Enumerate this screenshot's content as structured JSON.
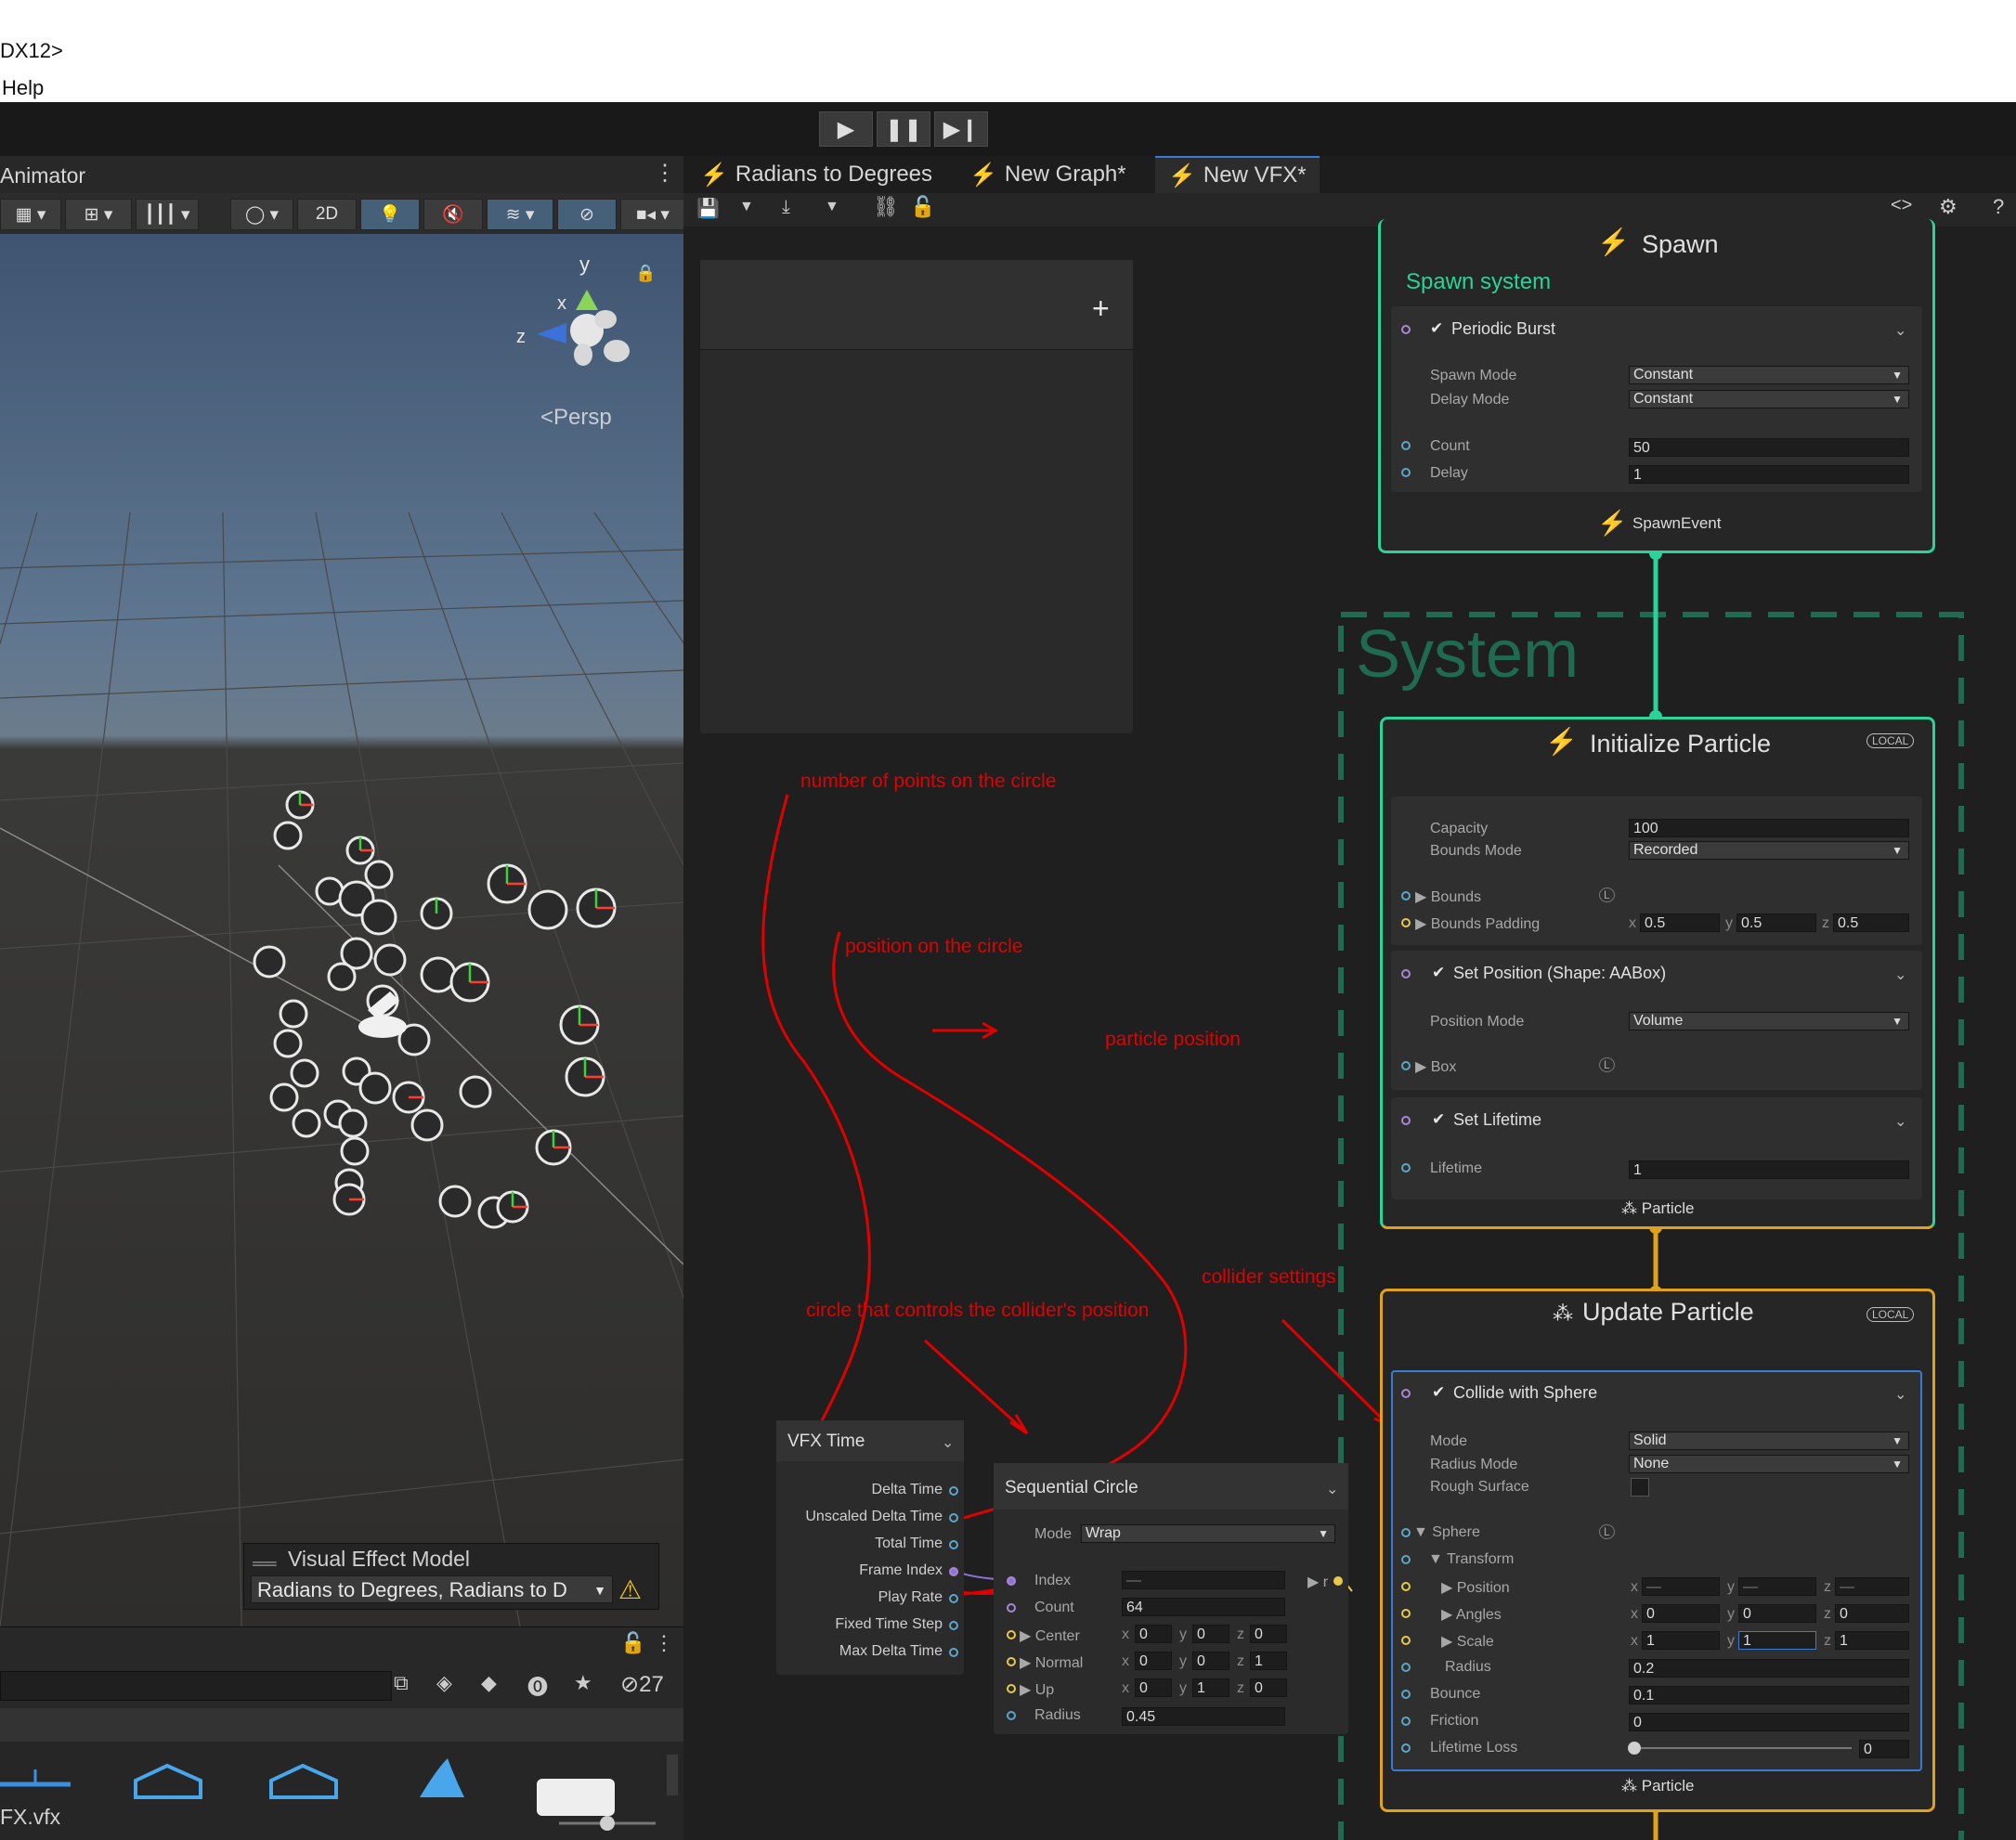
{
  "window": {
    "title_fragment": "DX12>",
    "menu_fragment": "Help"
  },
  "toolbar": {
    "play_icon": "play-icon",
    "pause_icon": "pause-icon",
    "step_icon": "step-icon"
  },
  "scene": {
    "tab_label": "Animator",
    "toolbar": {
      "mode_2d": "2D"
    },
    "gizmo": {
      "x": "x",
      "y": "y",
      "z": "z",
      "persp": "Persp"
    },
    "visual_effect_model": {
      "title": "Visual Effect Model",
      "value": "Radians to Degrees, Radians to D"
    }
  },
  "project": {
    "hidden_count": "27",
    "file_label": "FX.vfx"
  },
  "graph": {
    "tabs": [
      {
        "label": "Radians to Degrees"
      },
      {
        "label": "New Graph*"
      },
      {
        "label": "New VFX*"
      }
    ],
    "blackboard": {
      "add_label": "+"
    },
    "system_label": "System",
    "spawn": {
      "title": "Spawn",
      "subtitle": "Spawn system",
      "block_title": "Periodic Burst",
      "spawn_mode_label": "Spawn Mode",
      "spawn_mode": "Constant",
      "delay_mode_label": "Delay Mode",
      "delay_mode": "Constant",
      "count_label": "Count",
      "count": "50",
      "delay_label": "Delay",
      "delay": "1",
      "event_label": "SpawnEvent"
    },
    "initialize": {
      "title": "Initialize Particle",
      "local_tag": "LOCAL",
      "capacity_label": "Capacity",
      "capacity": "100",
      "bounds_mode_label": "Bounds Mode",
      "bounds_mode": "Recorded",
      "bounds_label": "Bounds",
      "bounds_padding_label": "Bounds Padding",
      "bounds_padding": {
        "x": "0.5",
        "y": "0.5",
        "z": "0.5"
      },
      "set_position_title": "Set Position (Shape: AABox)",
      "position_mode_label": "Position Mode",
      "position_mode": "Volume",
      "box_label": "Box",
      "set_lifetime_title": "Set Lifetime",
      "lifetime_label": "Lifetime",
      "lifetime": "1",
      "out_label": "Particle"
    },
    "update": {
      "title": "Update Particle",
      "local_tag": "LOCAL",
      "collide_title": "Collide with Sphere",
      "mode_label": "Mode",
      "mode": "Solid",
      "radius_mode_label": "Radius Mode",
      "radius_mode": "None",
      "rough_surface_label": "Rough Surface",
      "sphere_label": "Sphere",
      "transform_label": "Transform",
      "position_label": "Position",
      "position": {
        "x": "—",
        "y": "—",
        "z": "—"
      },
      "angles_label": "Angles",
      "angles": {
        "x": "0",
        "y": "0",
        "z": "0"
      },
      "scale_label": "Scale",
      "scale": {
        "x": "1",
        "y": "1",
        "z": "1"
      },
      "radius_label": "Radius",
      "radius": "0.2",
      "bounce_label": "Bounce",
      "bounce": "0.1",
      "friction_label": "Friction",
      "friction": "0",
      "lifetime_loss_label": "Lifetime Loss",
      "lifetime_loss": "0",
      "lifetime_loss_fraction": 0,
      "out_label": "Particle"
    },
    "vfx_time": {
      "title": "VFX Time",
      "outputs": [
        "Delta Time",
        "Unscaled Delta Time",
        "Total Time",
        "Frame Index",
        "Play Rate",
        "Fixed Time Step",
        "Max Delta Time"
      ]
    },
    "sequential_circle": {
      "title": "Sequential Circle",
      "mode_label": "Mode",
      "mode": "Wrap",
      "index_label": "Index",
      "index": "—",
      "count_label": "Count",
      "count": "64",
      "center_label": "Center",
      "center": {
        "x": "0",
        "y": "0",
        "z": "0"
      },
      "normal_label": "Normal",
      "normal": {
        "x": "0",
        "y": "0",
        "z": "1"
      },
      "up_label": "Up",
      "up": {
        "x": "0",
        "y": "1",
        "z": "0"
      },
      "radius_label": "Radius",
      "radius": "0.45",
      "output_label": "r"
    }
  },
  "annotations": {
    "points": "number of points on the circle",
    "position": "position on the circle",
    "particle_position": "particle position",
    "collider_settings": "collider settings",
    "circle_controls": "circle that controls the collider's position"
  },
  "colors": {
    "accent_green": "#2ad39a",
    "accent_orange": "#e0a21a",
    "annotation_red": "#e00000"
  }
}
